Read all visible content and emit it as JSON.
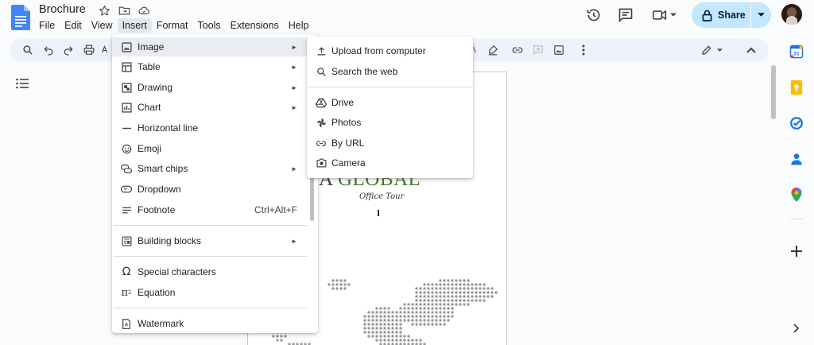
{
  "document": {
    "title": "Brochure"
  },
  "menubar": [
    "File",
    "Edit",
    "View",
    "Insert",
    "Format",
    "Tools",
    "Extensions",
    "Help"
  ],
  "header": {
    "share_label": "Share"
  },
  "insert_menu": {
    "items": [
      {
        "label": "Image",
        "icon": "image-icon",
        "submenu": true
      },
      {
        "label": "Table",
        "icon": "table-icon",
        "submenu": true
      },
      {
        "label": "Drawing",
        "icon": "drawing-icon",
        "submenu": true
      },
      {
        "label": "Chart",
        "icon": "chart-icon",
        "submenu": true
      },
      {
        "label": "Horizontal line",
        "icon": "horizontal-line-icon"
      },
      {
        "label": "Emoji",
        "icon": "emoji-icon"
      },
      {
        "label": "Smart chips",
        "icon": "smart-chips-icon",
        "submenu": true
      },
      {
        "label": "Dropdown",
        "icon": "dropdown-icon"
      },
      {
        "label": "Footnote",
        "icon": "footnote-icon",
        "shortcut": "Ctrl+Alt+F"
      },
      {
        "label": "Building blocks",
        "icon": "building-blocks-icon",
        "submenu": true
      },
      {
        "label": "Special characters",
        "icon": "omega-icon"
      },
      {
        "label": "Equation",
        "icon": "pi-icon"
      },
      {
        "label": "Watermark",
        "icon": "watermark-icon"
      }
    ]
  },
  "image_submenu": {
    "items": [
      {
        "label": "Upload from computer",
        "icon": "upload-icon"
      },
      {
        "label": "Search the web",
        "icon": "search-icon"
      },
      {
        "label": "Drive",
        "icon": "drive-icon"
      },
      {
        "label": "Photos",
        "icon": "photos-icon"
      },
      {
        "label": "By URL",
        "icon": "link-icon"
      },
      {
        "label": "Camera",
        "icon": "camera-icon"
      }
    ]
  },
  "page": {
    "title_part1": "AMMA",
    "title_part2": "GLOBAL",
    "subtitle": "Office Tour"
  },
  "colors": {
    "accent": "#c2e7ff",
    "title_green": "#3d7a2a",
    "menu_highlight": "#e9ecf0"
  }
}
